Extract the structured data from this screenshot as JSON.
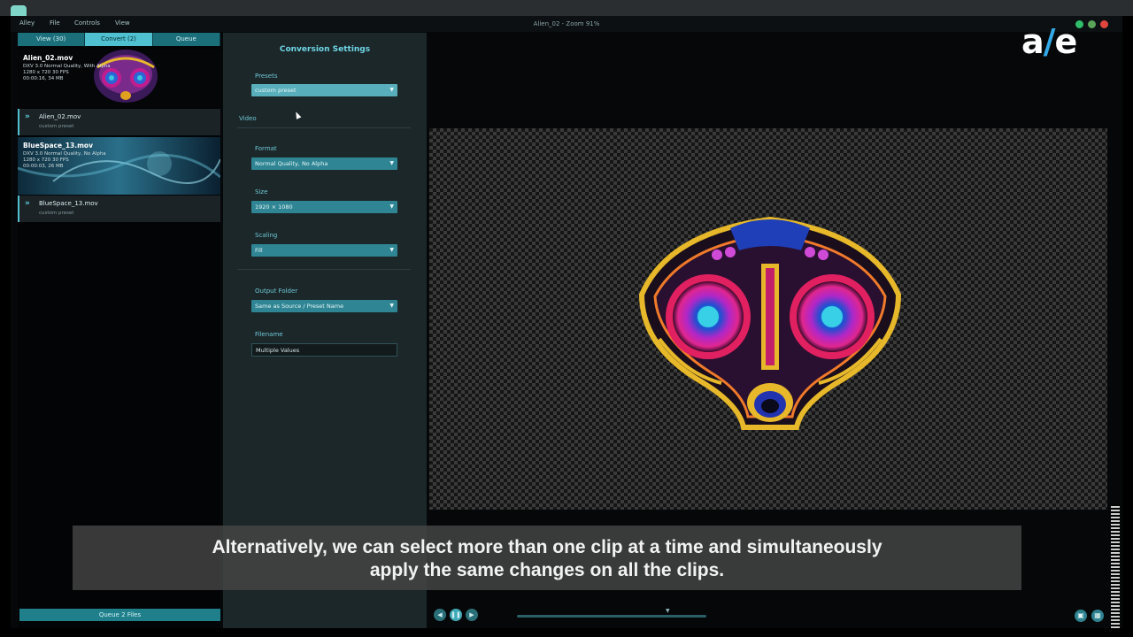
{
  "menubar": {
    "items": [
      "Alley",
      "File",
      "Controls",
      "View"
    ],
    "window_title": "Alien_02 - Zoom 91%"
  },
  "tabs": [
    "View (30)",
    "Convert (2)",
    "Queue"
  ],
  "files": [
    {
      "name": "Alien_02.mov",
      "line1": "DXV 3.0 Normal Quality, With Alpha",
      "line2": "1280 x 720 30 FPS",
      "line3": "00:00:16, 34 MB",
      "row_name": "Alien_02.mov",
      "row_sub": "custom preset"
    },
    {
      "name": "BlueSpace_13.mov",
      "line1": "DXV 3.0 Normal Quality, No Alpha",
      "line2": "1280 x 720 30 FPS",
      "line3": "00:00:03, 26 MB",
      "row_name": "BlueSpace_13.mov",
      "row_sub": "custom preset"
    }
  ],
  "queue_button": "Queue 2 Files",
  "settings": {
    "heading": "Conversion Settings",
    "presets_label": "Presets",
    "presets_value": "custom preset",
    "video_section": "Video",
    "format_label": "Format",
    "format_value": "Normal Quality, No Alpha",
    "size_label": "Size",
    "size_value": "1920 × 1080",
    "scaling_label": "Scaling",
    "scaling_value": "Fill",
    "output_label": "Output Folder",
    "output_value": "Same as Source / Preset Name",
    "filename_label": "Filename",
    "filename_value": "Multiple Values"
  },
  "logo": {
    "a": "a",
    "slash": "/",
    "e": "e"
  },
  "caption": {
    "line1": "Alternatively, we can select more than one clip at a time and simultaneously",
    "line2": "apply the same changes on all the clips."
  },
  "icons": {
    "traffic": [
      "#2fbf6a",
      "#e8b33a",
      "#e0463d"
    ],
    "accent": "#4ec0d0"
  }
}
